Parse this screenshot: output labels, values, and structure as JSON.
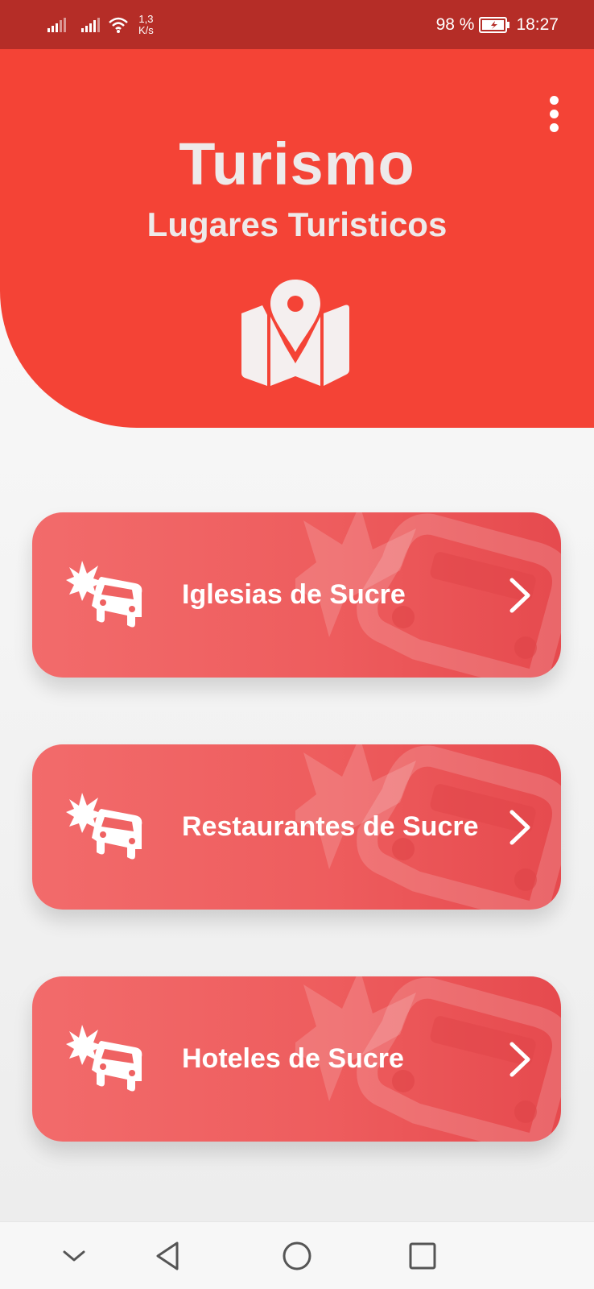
{
  "status_bar": {
    "speed_value": "1,3",
    "speed_unit": "K/s",
    "battery": "98 %",
    "time": "18:27"
  },
  "header": {
    "title": "Turismo",
    "subtitle": "Lugares Turisticos",
    "icon": "map-pin-icon"
  },
  "cards": [
    {
      "label": "Iglesias de Sucre",
      "icon": "car-crash-icon"
    },
    {
      "label": "Restaurantes de Sucre",
      "icon": "car-crash-icon"
    },
    {
      "label": "Hoteles de Sucre",
      "icon": "car-crash-icon"
    }
  ],
  "colors": {
    "status_bar": "#b52d27",
    "header": "#f44336",
    "card": "#ef6262"
  }
}
